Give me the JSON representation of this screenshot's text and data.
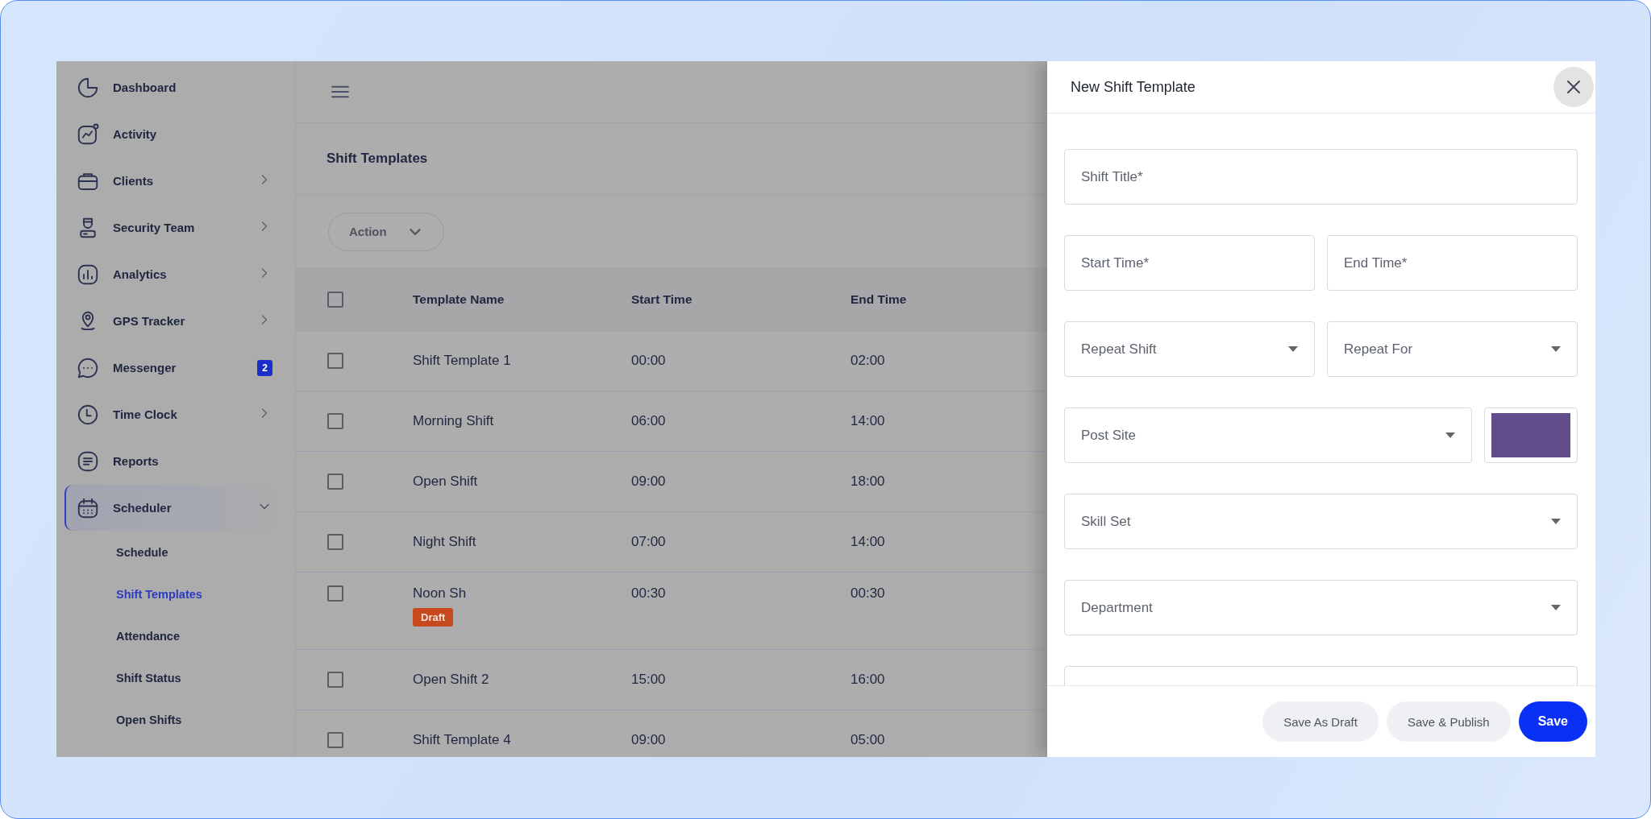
{
  "sidebar": {
    "items": [
      {
        "label": "Dashboard",
        "kind": "dashboard",
        "selected": false
      },
      {
        "label": "Activity",
        "kind": "activity",
        "selected": false
      },
      {
        "label": "Clients",
        "kind": "clients",
        "expanded": false,
        "selected": false
      },
      {
        "label": "Security Team",
        "kind": "team",
        "expanded": false,
        "selected": false
      },
      {
        "label": "Analytics",
        "kind": "analytics",
        "expanded": false,
        "selected": false
      },
      {
        "label": "GPS Tracker",
        "kind": "gps",
        "expanded": false,
        "selected": false
      },
      {
        "label": "Messenger",
        "kind": "messenger",
        "selected": false,
        "badge": "2"
      },
      {
        "label": "Time Clock",
        "kind": "clock",
        "expanded": false,
        "selected": false
      },
      {
        "label": "Reports",
        "kind": "reports",
        "selected": false
      },
      {
        "label": "Scheduler",
        "kind": "scheduler",
        "expanded": true,
        "selected": true,
        "children": [
          {
            "label": "Schedule",
            "selected": false
          },
          {
            "label": "Shift Templates",
            "selected": true
          },
          {
            "label": "Attendance",
            "selected": false
          },
          {
            "label": "Shift Status",
            "selected": false
          },
          {
            "label": "Open Shifts",
            "selected": false
          }
        ]
      }
    ]
  },
  "main": {
    "page_title": "Shift Templates",
    "action_button": "Action",
    "table": {
      "select_all_checked": false,
      "columns": [
        "Template Name",
        "Start Time",
        "End Time"
      ],
      "rows": [
        {
          "checked": false,
          "cells": [
            "Shift Template 1",
            "00:00",
            "02:00"
          ]
        },
        {
          "checked": false,
          "cells": [
            "Morning Shift",
            "06:00",
            "14:00"
          ]
        },
        {
          "checked": false,
          "cells": [
            "Open Shift",
            "09:00",
            "18:00"
          ]
        },
        {
          "checked": false,
          "cells": [
            "Night Shift",
            "07:00",
            "14:00"
          ]
        },
        {
          "checked": false,
          "cells": [
            "Noon Sh",
            "00:30",
            "00:30"
          ],
          "badge": "Draft"
        },
        {
          "checked": false,
          "cells": [
            "Open Shift 2",
            "15:00",
            "16:00"
          ]
        },
        {
          "checked": false,
          "cells": [
            "Shift Template 4",
            "09:00",
            "05:00"
          ]
        }
      ]
    }
  },
  "modal": {
    "title": "New Shift Template",
    "field_rows": [
      [
        {
          "kind": "text",
          "placeholder": "Shift Title*"
        }
      ],
      [
        {
          "kind": "text",
          "placeholder": "Start Time*"
        },
        {
          "kind": "text",
          "placeholder": "End Time*"
        }
      ],
      [
        {
          "kind": "select",
          "label": "Repeat Shift"
        },
        {
          "kind": "select",
          "label": "Repeat For"
        }
      ],
      [
        {
          "kind": "select",
          "label": "Post Site"
        },
        {
          "kind": "color",
          "color": "#614d8c"
        }
      ],
      [
        {
          "kind": "select",
          "label": "Skill Set"
        }
      ],
      [
        {
          "kind": "select",
          "label": "Department"
        }
      ]
    ],
    "buttons": [
      {
        "label": "Save As Draft",
        "primary": false
      },
      {
        "label": "Save & Publish",
        "primary": false
      },
      {
        "label": "Save",
        "primary": true
      }
    ]
  }
}
